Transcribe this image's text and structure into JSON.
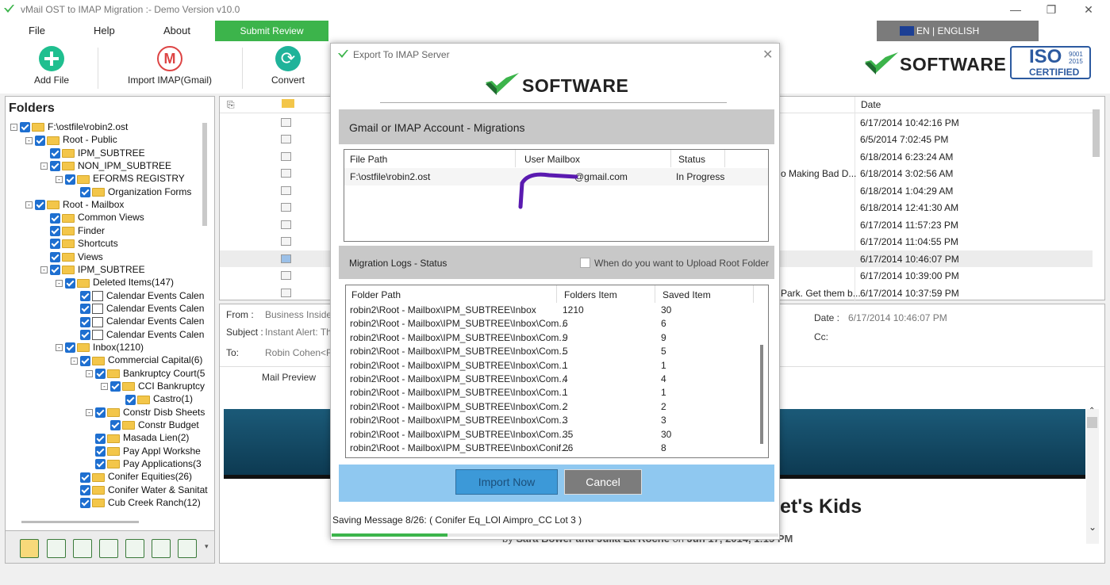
{
  "app": {
    "title": "vMail OST to IMAP Migration :- Demo Version v10.0"
  },
  "menu": [
    "File",
    "Help",
    "About"
  ],
  "submit_review": "Submit Review",
  "language": "EN | ENGLISH",
  "toolbar": {
    "add_file": "Add File",
    "import_imap": "Import IMAP(Gmail)",
    "convert": "Convert"
  },
  "brand": {
    "name": "SOFTWARE",
    "iso": "ISO",
    "iso_years": "9001\n2015",
    "iso_cert": "CERTIFIED"
  },
  "folders": {
    "header": "Folders",
    "items": [
      {
        "label": "F:\\ostfile\\robin2.ost",
        "level": 0,
        "exp": "-"
      },
      {
        "label": "Root - Public",
        "level": 1,
        "exp": "-"
      },
      {
        "label": "IPM_SUBTREE",
        "level": 2,
        "exp": ""
      },
      {
        "label": "NON_IPM_SUBTREE",
        "level": 2,
        "exp": "-"
      },
      {
        "label": "EFORMS REGISTRY",
        "level": 3,
        "exp": "-"
      },
      {
        "label": "Organization Forms",
        "level": 4,
        "exp": ""
      },
      {
        "label": "Root - Mailbox",
        "level": 1,
        "exp": "-"
      },
      {
        "label": "Common Views",
        "level": 2,
        "exp": ""
      },
      {
        "label": "Finder",
        "level": 2,
        "exp": ""
      },
      {
        "label": "Shortcuts",
        "level": 2,
        "exp": ""
      },
      {
        "label": "Views",
        "level": 2,
        "exp": ""
      },
      {
        "label": "IPM_SUBTREE",
        "level": 2,
        "exp": "-"
      },
      {
        "label": "Deleted Items(147)",
        "level": 3,
        "exp": "-"
      },
      {
        "label": "Calendar Events Calen",
        "level": 4,
        "exp": "",
        "cal": true
      },
      {
        "label": "Calendar Events Calen",
        "level": 4,
        "exp": "",
        "cal": true
      },
      {
        "label": "Calendar Events Calen",
        "level": 4,
        "exp": "",
        "cal": true
      },
      {
        "label": "Calendar Events Calen",
        "level": 4,
        "exp": "",
        "cal": true
      },
      {
        "label": "Inbox(1210)",
        "level": 3,
        "exp": "-"
      },
      {
        "label": "Commercial Capital(6)",
        "level": 4,
        "exp": "-"
      },
      {
        "label": "Bankruptcy Court(5",
        "level": 5,
        "exp": "-"
      },
      {
        "label": "CCI Bankruptcy",
        "level": 6,
        "exp": "-"
      },
      {
        "label": "Castro(1)",
        "level": 7,
        "exp": ""
      },
      {
        "label": "Constr Disb Sheets",
        "level": 5,
        "exp": "-"
      },
      {
        "label": "Constr Budget",
        "level": 6,
        "exp": ""
      },
      {
        "label": "Masada Lien(2)",
        "level": 5,
        "exp": ""
      },
      {
        "label": "Pay Appl Workshe",
        "level": 5,
        "exp": ""
      },
      {
        "label": "Pay Applications(3",
        "level": 5,
        "exp": ""
      },
      {
        "label": "Conifer Equities(26)",
        "level": 4,
        "exp": ""
      },
      {
        "label": "Conifer Water & Sanitat",
        "level": 4,
        "exp": ""
      },
      {
        "label": "Cub Creek Ranch(12)",
        "level": 4,
        "exp": ""
      }
    ]
  },
  "maillist": {
    "date_header": "Date",
    "rows": [
      {
        "subject": "",
        "date": "6/17/2014 10:42:16 PM"
      },
      {
        "subject": "",
        "date": "6/5/2014 7:02:45 PM"
      },
      {
        "subject": "",
        "date": "6/18/2014 6:23:24 AM"
      },
      {
        "subject": "o Making Bad D...",
        "date": "6/18/2014 3:02:56 AM"
      },
      {
        "subject": "",
        "date": "6/18/2014 1:04:29 AM"
      },
      {
        "subject": "",
        "date": "6/18/2014 12:41:30 AM"
      },
      {
        "subject": "",
        "date": "6/17/2014 11:57:23 PM"
      },
      {
        "subject": "",
        "date": "6/17/2014 11:04:55 PM"
      },
      {
        "subject": "",
        "date": "6/17/2014 10:46:07 PM"
      },
      {
        "subject": "",
        "date": "6/17/2014 10:39:00 PM"
      },
      {
        "subject": "Park. Get them b...",
        "date": "6/17/2014 10:37:59 PM"
      }
    ]
  },
  "preview": {
    "from_label": "From :",
    "from_value": "Business Insider",
    "subject_label": "Subject :",
    "subject_value": "Instant Alert: The",
    "to_label": "To:",
    "to_value": "Robin Cohen<Ro",
    "date_label": "Date :",
    "date_value": "6/17/2014 10:46:07 PM",
    "cc_label": "Cc:",
    "tab": "Mail Preview",
    "headline": "et's Kids",
    "byline_pre": "by ",
    "byline_names": "Sara Bower and Julia La Roche",
    "byline_mid": " on ",
    "byline_date": "Jun 17, 2014, 1:15 PM"
  },
  "dialog": {
    "title": "Export To IMAP Server",
    "logo": "SOFTWARE",
    "section_account": "Gmail or IMAP Account - Migrations",
    "table_account": {
      "headers": [
        "File Path",
        "User Mailbox",
        "Status"
      ],
      "row": {
        "path": "F:\\ostfile\\robin2.ost",
        "mailbox": "@gmail.com",
        "status": "In Progress"
      }
    },
    "section_logs": "Migration Logs - Status",
    "upload_root": "When do you want to Upload Root Folder",
    "table_logs": {
      "headers": [
        "Folder Path",
        "Folders Item",
        "Saved Item"
      ],
      "rows": [
        [
          "robin2\\Root - Mailbox\\IPM_SUBTREE\\Inbox",
          "1210",
          "30"
        ],
        [
          "robin2\\Root - Mailbox\\IPM_SUBTREE\\Inbox\\Com...",
          "6",
          "6"
        ],
        [
          "robin2\\Root - Mailbox\\IPM_SUBTREE\\Inbox\\Com...",
          "9",
          "9"
        ],
        [
          "robin2\\Root - Mailbox\\IPM_SUBTREE\\Inbox\\Com...",
          "5",
          "5"
        ],
        [
          "robin2\\Root - Mailbox\\IPM_SUBTREE\\Inbox\\Com...",
          "1",
          "1"
        ],
        [
          "robin2\\Root - Mailbox\\IPM_SUBTREE\\Inbox\\Com...",
          "4",
          "4"
        ],
        [
          "robin2\\Root - Mailbox\\IPM_SUBTREE\\Inbox\\Com...",
          "1",
          "1"
        ],
        [
          "robin2\\Root - Mailbox\\IPM_SUBTREE\\Inbox\\Com...",
          "2",
          "2"
        ],
        [
          "robin2\\Root - Mailbox\\IPM_SUBTREE\\Inbox\\Com...",
          "3",
          "3"
        ],
        [
          "robin2\\Root - Mailbox\\IPM_SUBTREE\\Inbox\\Com...",
          "35",
          "30"
        ],
        [
          "robin2\\Root - Mailbox\\IPM_SUBTREE\\Inbox\\Conif...",
          "26",
          "8"
        ]
      ]
    },
    "import_now": "Import Now",
    "cancel": "Cancel",
    "saving_message": "Saving Message 8/26: ( Conifer Eq_LOI Aimpro_CC Lot 3 )",
    "progress": 0.26
  },
  "colors": {
    "accent_green": "#3cb44b",
    "import_blue": "#3c99d8",
    "banner": "#1b5a78"
  }
}
